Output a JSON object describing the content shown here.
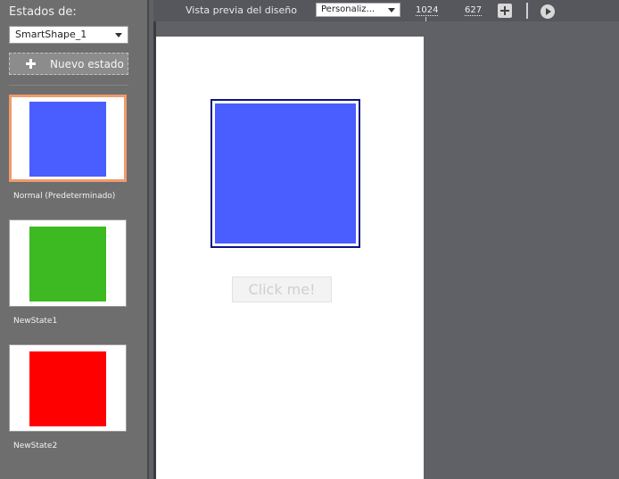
{
  "states_panel": {
    "title": "Estados de:",
    "shape_select": "SmartShape_1",
    "new_state_label": "Nuevo estado",
    "states": [
      {
        "name": "Normal (Predeterminado)",
        "color": "#4a5dff",
        "selected": true
      },
      {
        "name": "NewState1",
        "color": "#3dba21",
        "selected": false
      },
      {
        "name": "NewState2",
        "color": "#ff0000",
        "selected": false
      }
    ]
  },
  "toolbar": {
    "preview_label": "Vista previa del diseño",
    "size_select": "Personaliz...",
    "width_value": "1024",
    "height_value": "627",
    "add_icon": "add-icon",
    "play_icon": "play-icon"
  },
  "stage": {
    "shape_color": "#4a5dff",
    "button_label": "Click me!"
  },
  "colors": {
    "panel_bg": "#6e6e6e",
    "stage_bg": "#5f6166",
    "selection_border": "#f09a6c",
    "shape_border": "#0a1680"
  }
}
